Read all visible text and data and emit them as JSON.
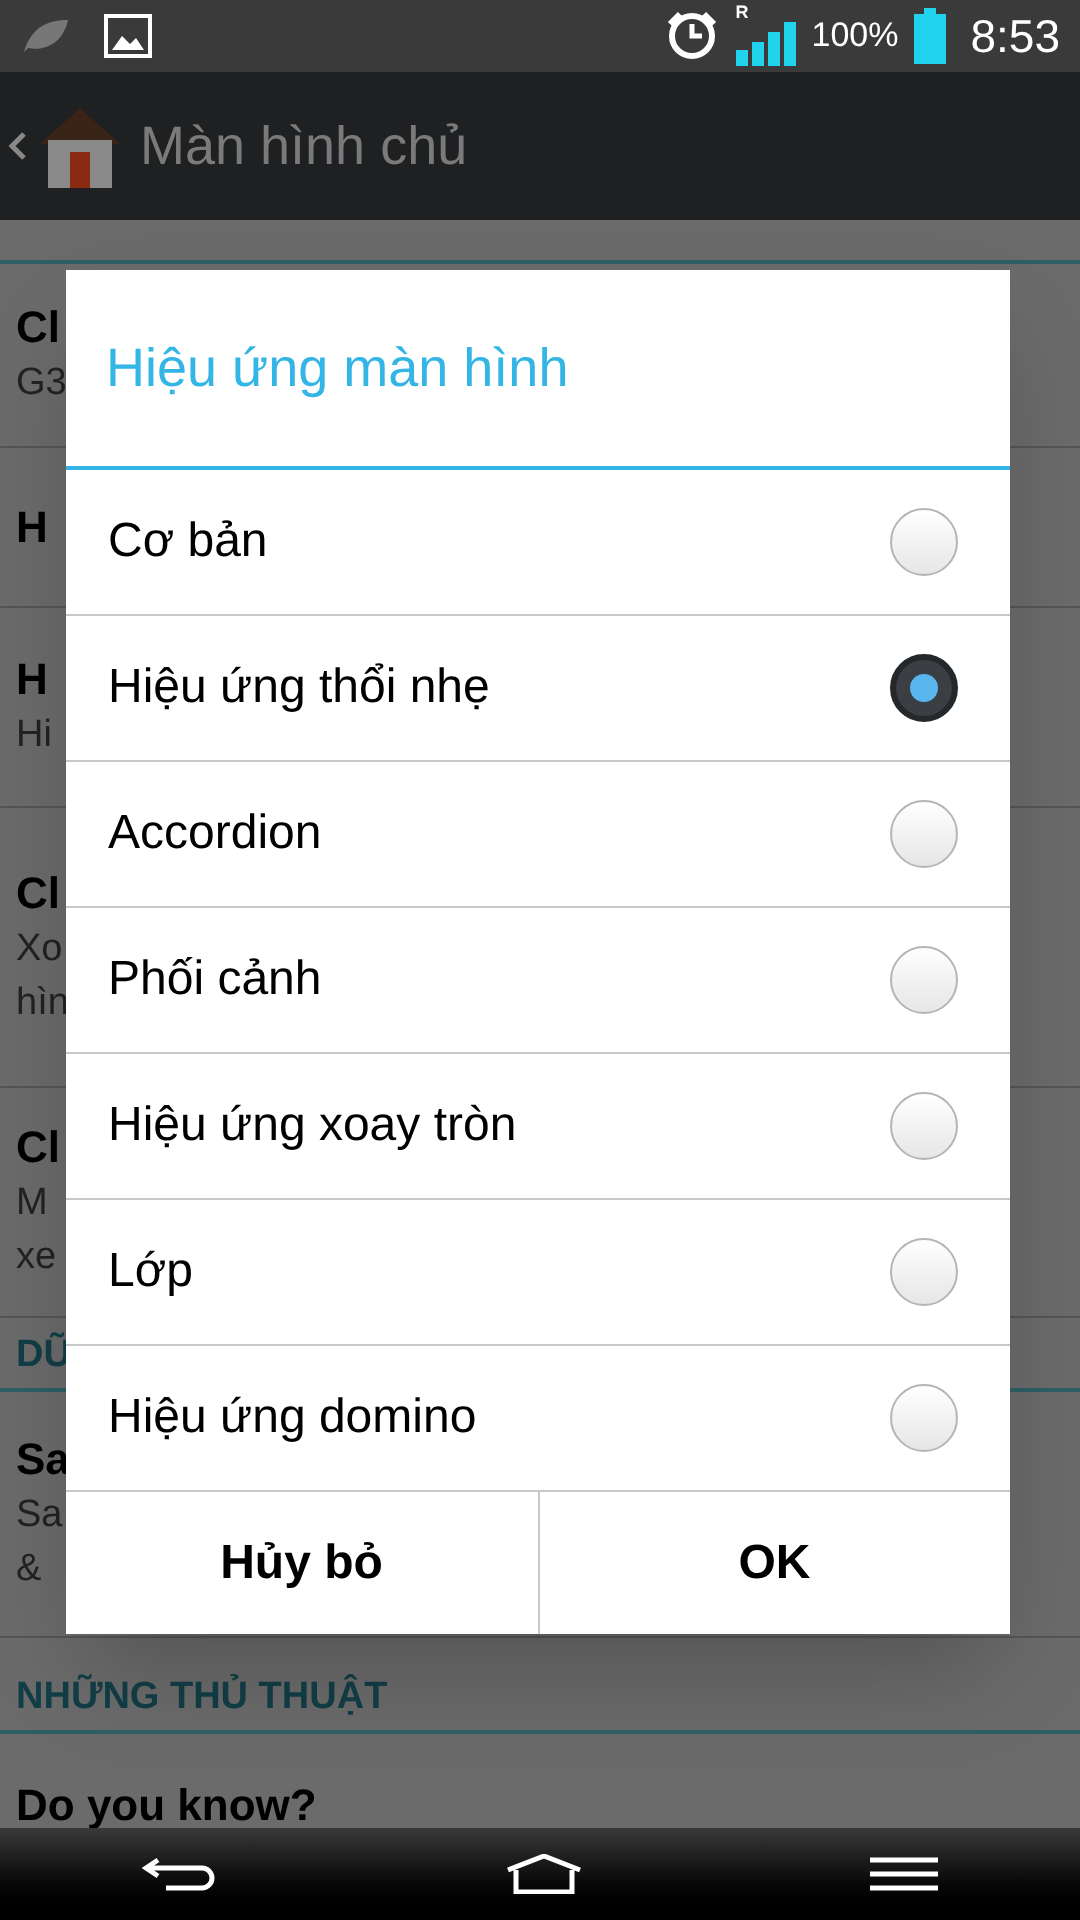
{
  "status_bar": {
    "roaming": "R",
    "battery": "100%",
    "time": "8:53"
  },
  "app_bar": {
    "title": "Màn hình chủ"
  },
  "background_list": [
    {
      "kind": "row",
      "title": "Cl",
      "lines": [
        "G3"
      ]
    },
    {
      "kind": "row",
      "title": "H"
    },
    {
      "kind": "row",
      "title": "H",
      "lines": [
        "Hi"
      ]
    },
    {
      "kind": "row",
      "title": "Cl",
      "lines": [
        "Xo",
        "hìn"
      ]
    },
    {
      "kind": "row",
      "title": "Cl",
      "lines": [
        "M",
        "xe"
      ]
    },
    {
      "kind": "section",
      "title": "DŨ"
    },
    {
      "kind": "row",
      "title": "Sa",
      "lines": [
        "Sa",
        "&"
      ]
    },
    {
      "kind": "section",
      "title": "NHỮNG THỦ THUẬT"
    },
    {
      "kind": "last",
      "title": "Do you know?"
    }
  ],
  "dialog": {
    "title": "Hiệu ứng màn hình",
    "options": [
      {
        "label": "Cơ bản",
        "selected": false
      },
      {
        "label": "Hiệu ứng thổi nhẹ",
        "selected": true
      },
      {
        "label": "Accordion",
        "selected": false
      },
      {
        "label": "Phối cảnh",
        "selected": false
      },
      {
        "label": "Hiệu ứng xoay tròn",
        "selected": false
      },
      {
        "label": "Lớp",
        "selected": false
      },
      {
        "label": "Hiệu ứng domino",
        "selected": false
      }
    ],
    "buttons": [
      "Hủy bỏ",
      "OK"
    ]
  }
}
